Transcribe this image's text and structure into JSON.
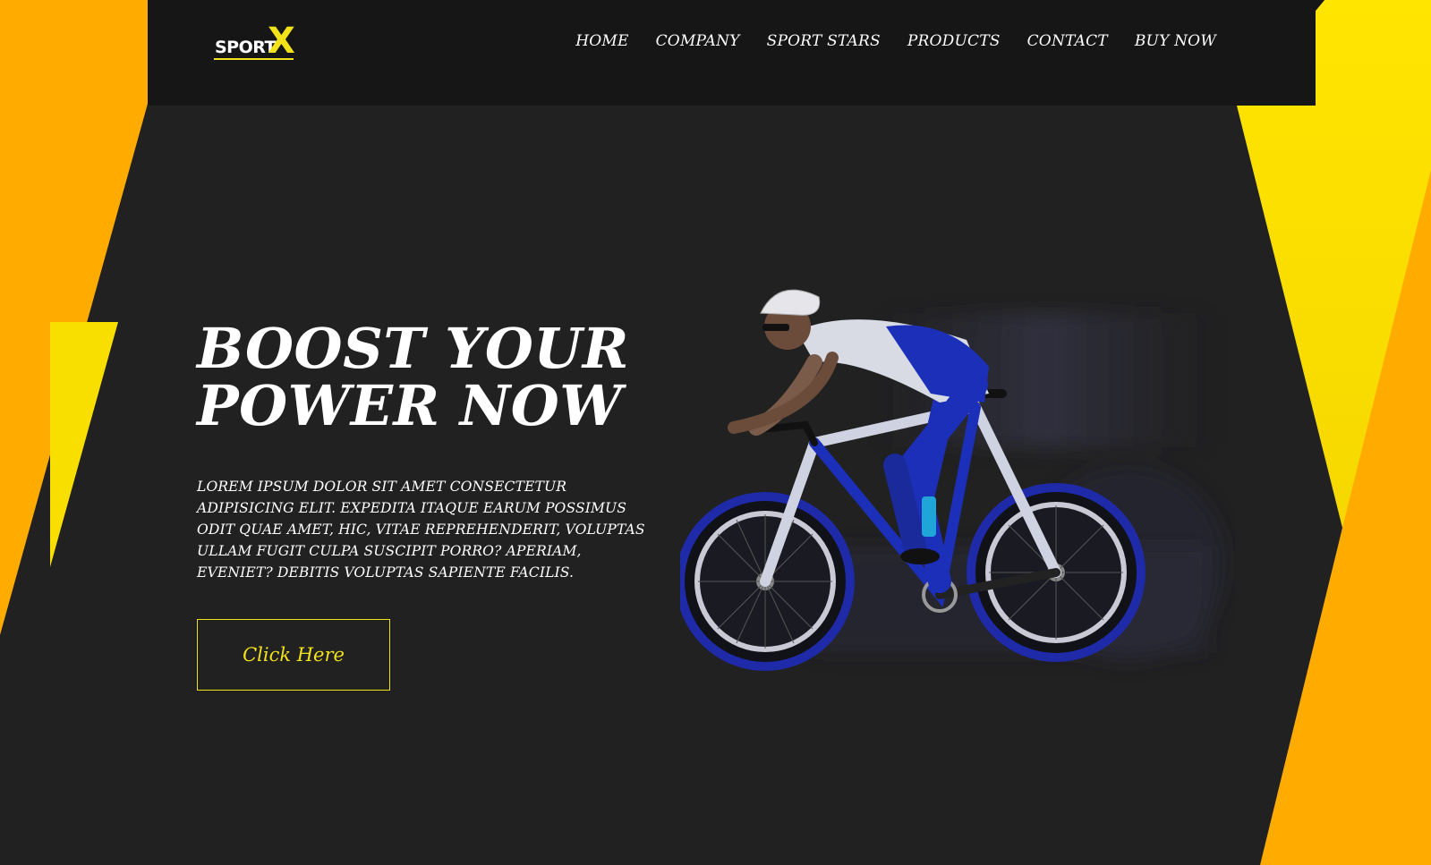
{
  "brand": {
    "logo_word": "SPORT",
    "logo_mark": "X"
  },
  "nav": {
    "items": [
      {
        "label": "HOME"
      },
      {
        "label": "COMPANY"
      },
      {
        "label": "SPORT STARS"
      },
      {
        "label": "PRODUCTS"
      },
      {
        "label": "CONTACT"
      },
      {
        "label": "BUY NOW"
      }
    ]
  },
  "hero": {
    "title_line1": "BOOST YOUR",
    "title_line2": "POWER NOW",
    "description": "LOREM IPSUM DOLOR SIT AMET CONSECTETUR ADIPISICING ELIT. EXPEDITA ITAQUE EARUM POSSIMUS ODIT QUAE AMET, HIC, VITAE REPREHENDERIT, VOLUPTAS ULLAM FUGIT CULPA SUSCIPIT PORRO? APERIAM, EVENIET? DEBITIS VOLUPTAS SAPIENTE FACILIS.",
    "cta_label": "Click Here"
  },
  "colors": {
    "background": "#212121",
    "header": "#161616",
    "orange": "#ffab00",
    "yellow": "#f9df00",
    "accent": "#f2e21a",
    "text": "#ffffff"
  },
  "icons": {
    "hero_image": "cyclist-illustration"
  }
}
